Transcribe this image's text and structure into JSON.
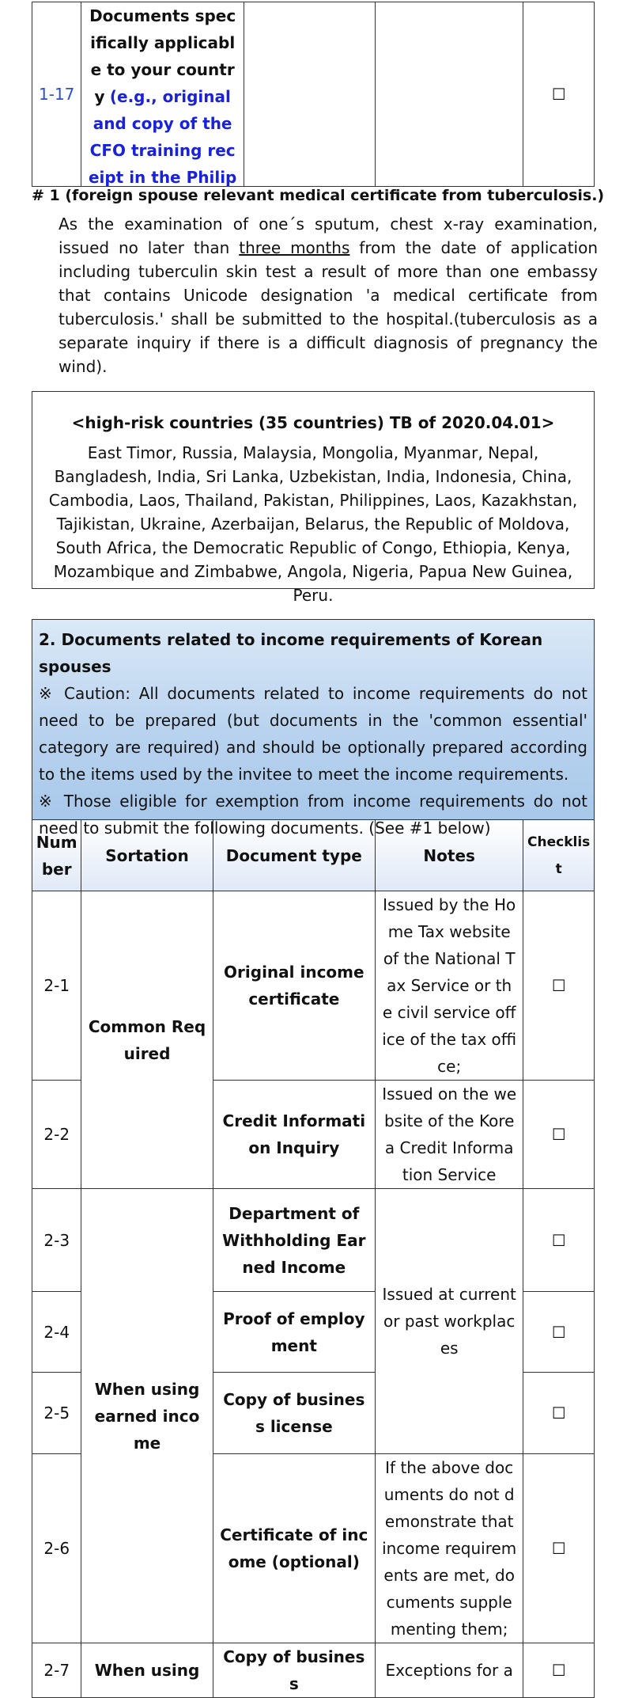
{
  "top_row": {
    "number": "1-17",
    "doc_text_black": "Documents specifically applicable to your country",
    "doc_text_blue": "(e.g., original and copy of the CFO training receipt in the Philippines)",
    "checkbox": "☐"
  },
  "note": {
    "title": "# 1 (foreign spouse relevant medical certificate from tuberculosis.)",
    "body_before": "As the examination of one´s sputum, chest x-ray examination, issued no later than ",
    "body_underline": "three months",
    "body_after": " from the date of application including tuberculin skin test a result of more than one embassy that contains Unicode designation 'a medical certificate from tuberculosis.' shall be submitted to the hospital.(tuberculosis as a separate inquiry if there is a difficult diagnosis of pregnancy the wind)."
  },
  "high_risk": {
    "title": "<high-risk countries (35 countries) TB of 2020.04.01>",
    "countries": "East Timor, Russia, Malaysia, Mongolia, Myanmar, Nepal, Bangladesh, India, Sri Lanka, Uzbekistan, India, Indonesia, China, Cambodia, Laos, Thailand, Pakistan, Philippines, Laos, Kazakhstan, Tajikistan, Ukraine, Azerbaijan, Belarus, the Republic of Moldova, South Africa, the Democratic Republic of Congo, Ethiopia, Kenya, Mozambique and Zimbabwe, Angola, Nigeria, Papua New Guinea, Peru."
  },
  "section2": {
    "title": "2. Documents related to income requirements of Korean spouses",
    "caution1": "※ Caution: All documents related to income requirements do not need to be prepared (but documents in the 'common essential' category are required) and should be optionally prepared according to the items used by the invitee to meet the income requirements.",
    "caution2": "※ Those eligible for exemption from income requirements do not need to submit the following documents. (See #1 below)",
    "headers": {
      "number": "Number",
      "sortation": "Sortation",
      "document_type": "Document type",
      "notes": "Notes",
      "checklist": "Checklist"
    },
    "groups": {
      "common": "Common Required",
      "earned": "When using earned income",
      "last": "When using"
    },
    "rows": [
      {
        "number": "2-1",
        "document": "Original income certificate",
        "note": "Issued by the Home Tax website of the National Tax Service or the civil service office of the tax office;",
        "check": "☐"
      },
      {
        "number": "2-2",
        "document": "Credit Information Inquiry",
        "note": "Issued on the website of the Korea Credit Information Service",
        "check": "☐"
      },
      {
        "number": "2-3",
        "document": "Department of Withholding Earned Income",
        "note": "Issued at current or past workplaces",
        "check": "☐"
      },
      {
        "number": "2-4",
        "document": "Proof of employment",
        "check": "☐"
      },
      {
        "number": "2-5",
        "document": "Copy of business license",
        "check": "☐"
      },
      {
        "number": "2-6",
        "document": "Certificate of income (optional)",
        "note": "If the above documents do not demonstrate that income requirements are met, documents supplementing them;",
        "check": "☐"
      },
      {
        "number": "2-7",
        "document": "Copy of business",
        "note": "Exceptions for a",
        "check": "☐"
      }
    ]
  }
}
